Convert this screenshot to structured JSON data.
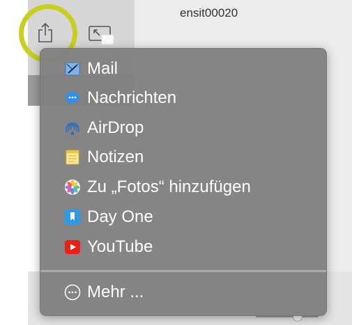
{
  "background": {
    "partial_text": "ensit00020"
  },
  "toolbar": {
    "share_icon": "share-icon",
    "pip_icon": "picture-in-picture-icon"
  },
  "share_menu": {
    "items": [
      {
        "label": "Mail",
        "icon": "mail-icon"
      },
      {
        "label": "Nachrichten",
        "icon": "messages-icon"
      },
      {
        "label": "AirDrop",
        "icon": "airdrop-icon"
      },
      {
        "label": "Notizen",
        "icon": "notes-icon"
      },
      {
        "label": "Zu „Fotos“ hinzufügen",
        "icon": "photos-icon"
      },
      {
        "label": "Day One",
        "icon": "day-one-icon"
      },
      {
        "label": "YouTube",
        "icon": "youtube-icon"
      }
    ],
    "more_label": "Mehr ...",
    "more_icon": "more-icon"
  },
  "colors": {
    "highlight_ring": "#c8cf1e",
    "menu_background": "#808080",
    "youtube_red": "#e62117",
    "messages_blue": "#2e8ff0"
  }
}
